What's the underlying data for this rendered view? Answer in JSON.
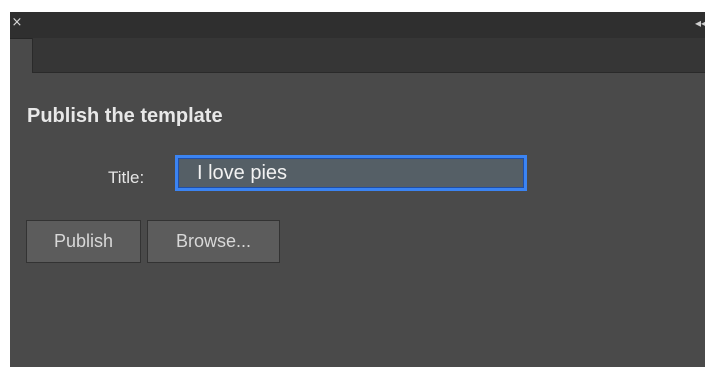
{
  "panel": {
    "close_symbol": "×",
    "collapse_symbol": "◂◂",
    "close_icon": "close-icon",
    "collapse_icon": "double-chevron-left-icon"
  },
  "form": {
    "heading": "Publish the template",
    "title_label": "Title:",
    "title_value": "I love pies"
  },
  "buttons": {
    "publish_label": "Publish",
    "browse_label": "Browse..."
  },
  "colors": {
    "panel_bg": "#4a4a4a",
    "titlebar_bg": "#2f2f2f",
    "input_focus_border": "#3b84f3"
  }
}
